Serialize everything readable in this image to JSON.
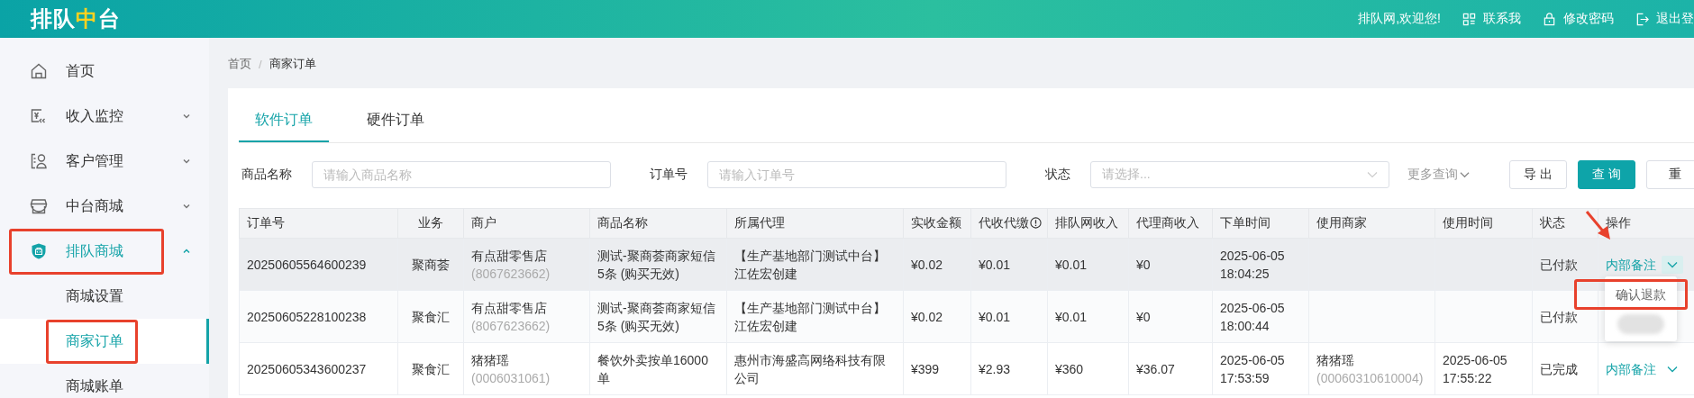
{
  "header": {
    "logo": [
      {
        "text": "排队",
        "accent": false
      },
      {
        "text": "中",
        "accent": true
      },
      {
        "text": "台",
        "accent": false
      }
    ],
    "welcome": "排队网,欢迎您!",
    "links": [
      {
        "kind": "contact",
        "label": "联系我"
      },
      {
        "kind": "lock",
        "label": "修改密码"
      },
      {
        "kind": "logout",
        "label": "退出登"
      }
    ]
  },
  "sidebar": {
    "items": [
      {
        "label": "首页",
        "kind": "home",
        "expandable": false,
        "selected": false,
        "annotated": false
      },
      {
        "label": "收入监控",
        "kind": "income",
        "expandable": true,
        "selected": false,
        "annotated": false
      },
      {
        "label": "客户管理",
        "kind": "customer",
        "expandable": true,
        "selected": false,
        "annotated": false
      },
      {
        "label": "中台商城",
        "kind": "store",
        "expandable": true,
        "selected": false,
        "annotated": false
      },
      {
        "label": "排队商城",
        "kind": "shield",
        "expandable": true,
        "expanded": true,
        "selected": true,
        "annotated": true,
        "children": [
          {
            "label": "商城设置",
            "selected": false,
            "annotated": false
          },
          {
            "label": "商家订单",
            "selected": true,
            "annotated": true
          },
          {
            "label": "商城账单",
            "selected": false,
            "annotated": false
          }
        ]
      }
    ]
  },
  "breadcrumb": {
    "separator": "/",
    "items": [
      "首页",
      "商家订单"
    ]
  },
  "tabs": [
    {
      "label": "软件订单",
      "selected": true
    },
    {
      "label": "硬件订单",
      "selected": false
    }
  ],
  "filters": [
    {
      "kind": "input",
      "label": "商品名称",
      "placeholder": "请输入商品名称"
    },
    {
      "kind": "input",
      "label": "订单号",
      "placeholder": "请输入订单号"
    },
    {
      "kind": "select",
      "label": "状态",
      "placeholder": "请选择..."
    }
  ],
  "more_query": "更多查询",
  "buttons": [
    {
      "kind": "default",
      "label": "导 出"
    },
    {
      "kind": "primary",
      "label": "查 询"
    },
    {
      "kind": "default",
      "label": "重"
    }
  ],
  "table": {
    "columns": [
      {
        "label": "订单号",
        "info": false
      },
      {
        "label": "业务",
        "info": false
      },
      {
        "label": "商户",
        "info": false
      },
      {
        "label": "商品名称",
        "info": false
      },
      {
        "label": "所属代理",
        "info": false
      },
      {
        "label": "实收金额",
        "info": false
      },
      {
        "label": "代收代缴",
        "info": true
      },
      {
        "label": "排队网收入",
        "info": false
      },
      {
        "label": "代理商收入",
        "info": false
      },
      {
        "label": "下单时间",
        "info": false
      },
      {
        "label": "使用商家",
        "info": false
      },
      {
        "label": "使用时间",
        "info": false
      },
      {
        "label": "状态",
        "info": false
      },
      {
        "label": "操作",
        "info": false
      }
    ],
    "rows": [
      {
        "hovered": true,
        "order_no": "20250605564600239",
        "business": "聚商荟",
        "merchant": {
          "name": "有点甜零售店",
          "id": "(8067623662)"
        },
        "product": "测试-聚商荟商家短信5条 (购买无效)",
        "agent": "【生产基地部门测试中台】江佐宏创建",
        "amount": "¥0.02",
        "collected": "¥0.01",
        "platform_income": "¥0.01",
        "agent_income": "¥0",
        "order_time": "2025-06-05 18:04:25",
        "status": "已付款",
        "action": {
          "label": "内部备注",
          "expanded": true,
          "arrow": true,
          "menu": {
            "items": [
              {
                "label": "确认退款",
                "annotated": true
              }
            ],
            "blurred_item": true
          }
        }
      },
      {
        "hovered": false,
        "order_no": "20250605228100238",
        "business": "聚食汇",
        "merchant": {
          "name": "有点甜零售店",
          "id": "(8067623662)"
        },
        "product": "测试-聚商荟商家短信5条 (购买无效)",
        "agent": "【生产基地部门测试中台】江佐宏创建",
        "amount": "¥0.02",
        "collected": "¥0.01",
        "platform_income": "¥0.01",
        "agent_income": "¥0",
        "order_time": "2025-06-05 18:00:44",
        "status": "已付款"
      },
      {
        "hovered": false,
        "order_no": "20250605343600237",
        "business": "聚食汇",
        "merchant": {
          "name": "猪猪瑶",
          "id": "(0006031061)"
        },
        "product": "餐饮外卖按单16000单",
        "agent": "惠州市海盛高网络科技有限公司",
        "amount": "¥399",
        "collected": "¥2.93",
        "platform_income": "¥360",
        "agent_income": "¥36.07",
        "order_time": "2025-06-05 17:53:59",
        "user_merchant": {
          "name": "猪猪瑶",
          "id": "(00060310610004)"
        },
        "use_time": "2025-06-05 17:55:22",
        "status": "已完成",
        "action": {
          "label": "内部备注",
          "expanded": false
        }
      }
    ]
  }
}
